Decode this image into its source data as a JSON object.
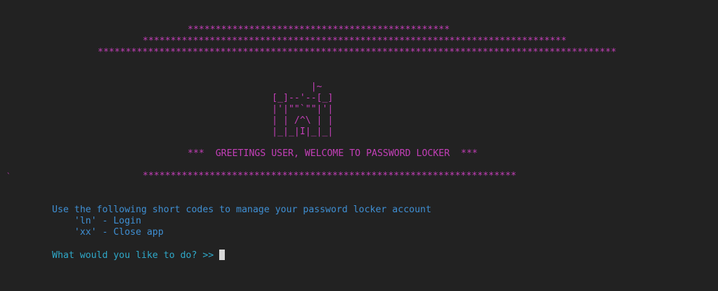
{
  "banner": {
    "stars_1": "***********************************************",
    "stars_2": "****************************************************************************",
    "stars_3": "*********************************************************************************************",
    "stars_bottom": "*******************************************************************"
  },
  "castle_ascii": "       |~\n[_]--'--[_]\n|'|\"\"`\"\"|'|\n| | /^\\ | |\n|_|_|I|_|_|",
  "greeting": "***  GREETINGS USER, WELCOME TO PASSWORD LOCKER  ***",
  "stray_mark": "`",
  "instructions": {
    "intro": "Use the following short codes to manage your password locker account",
    "codes": [
      "    'ln' - Login",
      "    'xx' - Close app"
    ]
  },
  "prompt": {
    "text": "What would you like to do? >> "
  },
  "colors": {
    "background": "#222222",
    "banner": "#c43fb8",
    "instructions": "#3f8fd3",
    "prompt": "#2fa9c9",
    "cursor": "#d8d8d8"
  }
}
